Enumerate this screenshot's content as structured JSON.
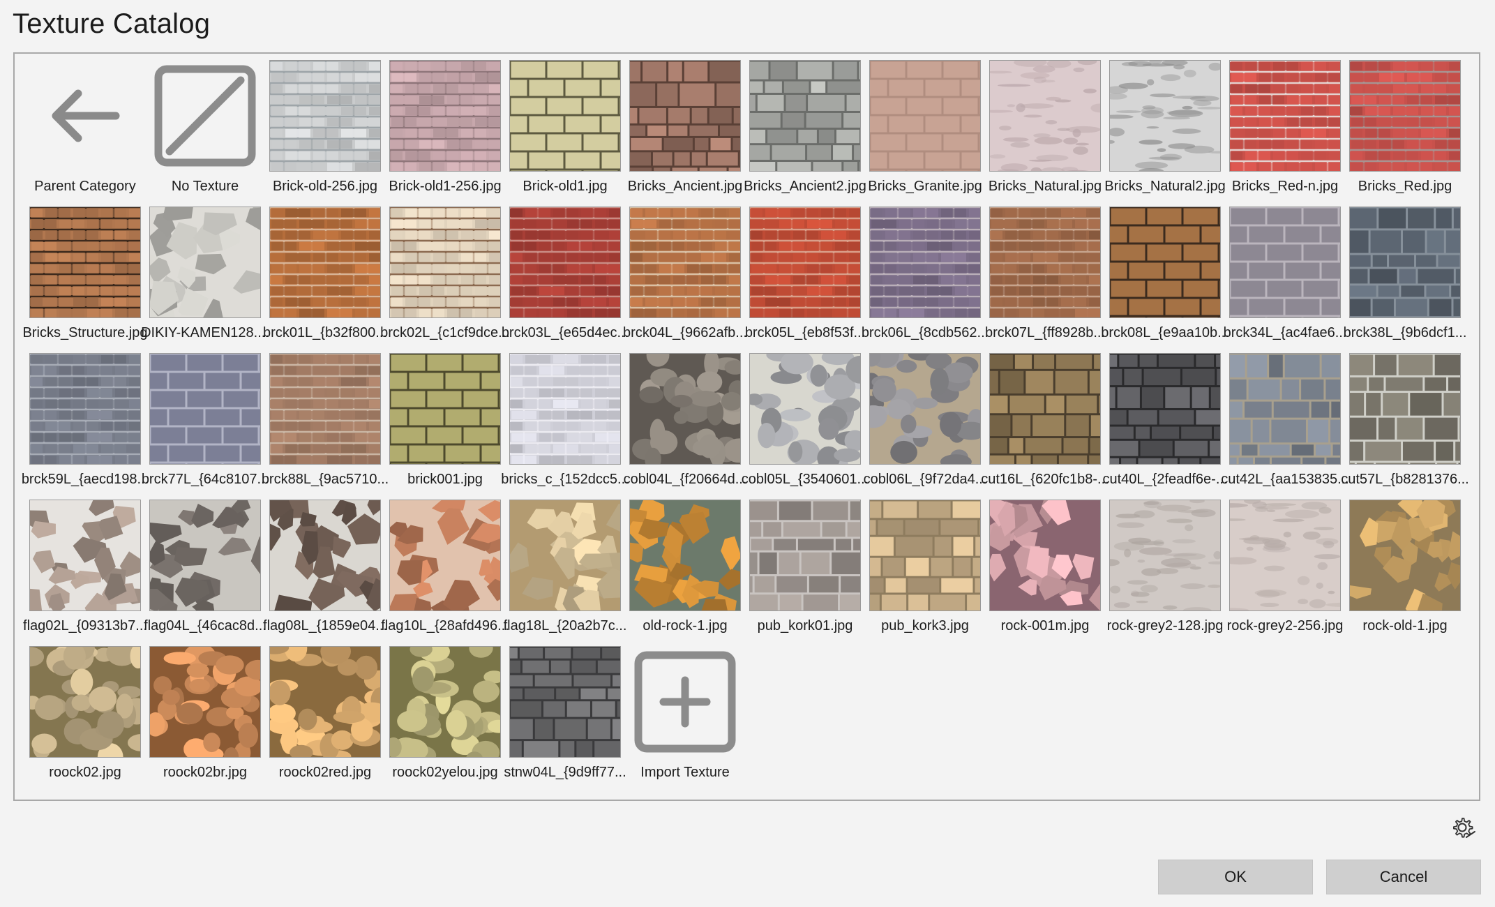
{
  "window": {
    "title": "Texture Catalog"
  },
  "special_items": {
    "parent": {
      "label": "Parent Category",
      "icon": "arrow-left-icon"
    },
    "none": {
      "label": "No Texture",
      "icon": "no-texture-icon"
    },
    "import": {
      "label": "Import Texture",
      "icon": "plus-square-icon"
    }
  },
  "textures": [
    {
      "label": "Brick-old-256.jpg",
      "colors": [
        "#c9cbcc",
        "#9ea5a9"
      ],
      "pattern": "brick"
    },
    {
      "label": "Brick-old1-256.jpg",
      "colors": [
        "#c7a7ac",
        "#8f767a"
      ],
      "pattern": "brick"
    },
    {
      "label": "Brick-old1.jpg",
      "colors": [
        "#d3cda0",
        "#5d5a40"
      ],
      "pattern": "block"
    },
    {
      "label": "Bricks_Ancient.jpg",
      "colors": [
        "#9d7566",
        "#5a4036"
      ],
      "pattern": "stone"
    },
    {
      "label": "Bricks_Ancient2.jpg",
      "colors": [
        "#a9aba7",
        "#6b6d6a"
      ],
      "pattern": "stone"
    },
    {
      "label": "Bricks_Granite.jpg",
      "colors": [
        "#c8a394",
        "#b08d7f"
      ],
      "pattern": "block"
    },
    {
      "label": "Bricks_Natural.jpg",
      "colors": [
        "#dccbcd",
        "#b9a6a9"
      ],
      "pattern": "rough"
    },
    {
      "label": "Bricks_Natural2.jpg",
      "colors": [
        "#d6d6d6",
        "#8f8f8f"
      ],
      "pattern": "rough"
    },
    {
      "label": "Bricks_Red-n.jpg",
      "colors": [
        "#c95049",
        "#e4d2cf"
      ],
      "pattern": "brick"
    },
    {
      "label": "Bricks_Red.jpg",
      "colors": [
        "#c8514c",
        "#a89391"
      ],
      "pattern": "brick"
    },
    {
      "label": "Bricks_Structure.jpg",
      "colors": [
        "#b1774f",
        "#3e2a1d"
      ],
      "pattern": "brick"
    },
    {
      "label": "DIKIY-KAMEN128....",
      "colors": [
        "#b8b7b2",
        "#dedcd7"
      ],
      "pattern": "flag"
    },
    {
      "label": "brck01L_{b32f800...",
      "colors": [
        "#b56d3b",
        "#d7b395"
      ],
      "pattern": "brick"
    },
    {
      "label": "brck02L_{c1cf9dce...",
      "colors": [
        "#e1d3bd",
        "#8b6a50"
      ],
      "pattern": "brick"
    },
    {
      "label": "brck03L_{e65d4ec...",
      "colors": [
        "#a83e36",
        "#c98c84"
      ],
      "pattern": "brick"
    },
    {
      "label": "brck04L_{9662afb...",
      "colors": [
        "#b36f44",
        "#d9c0a4"
      ],
      "pattern": "brick"
    },
    {
      "label": "brck05L_{eb8f53f...",
      "colors": [
        "#bf4b35",
        "#d99f8a"
      ],
      "pattern": "brick"
    },
    {
      "label": "brck06L_{8cdb562...",
      "colors": [
        "#7b6d88",
        "#b9aeb8"
      ],
      "pattern": "brick"
    },
    {
      "label": "brck07L_{ff8928b...",
      "colors": [
        "#9c6748",
        "#c6a38c"
      ],
      "pattern": "brick"
    },
    {
      "label": "brck08L_{e9aa10b...",
      "colors": [
        "#a57245",
        "#3b2b1e"
      ],
      "pattern": "block"
    },
    {
      "label": "brck34L_{ac4fae6...",
      "colors": [
        "#8d8893",
        "#bab5bd"
      ],
      "pattern": "block"
    },
    {
      "label": "brck38L_{9b6dcf1...",
      "colors": [
        "#5b6571",
        "#86909a"
      ],
      "pattern": "stone"
    },
    {
      "label": "brck59L_{aecd198...",
      "colors": [
        "#767b88",
        "#a7acb6"
      ],
      "pattern": "brick"
    },
    {
      "label": "brck77L_{64c8107...",
      "colors": [
        "#7c7f96",
        "#b2b4c6"
      ],
      "pattern": "block"
    },
    {
      "label": "brck88L_{9ac5710...",
      "colors": [
        "#a27b64",
        "#cab5a3"
      ],
      "pattern": "brick"
    },
    {
      "label": "brick001.jpg",
      "colors": [
        "#b1ac6f",
        "#4d4a2d"
      ],
      "pattern": "block"
    },
    {
      "label": "bricks_c_{152dcc5...",
      "colors": [
        "#cfcfd8",
        "#ecebf1"
      ],
      "pattern": "brick"
    },
    {
      "label": "cobl04L_{f20664d...",
      "colors": [
        "#8c857c",
        "#5f5953"
      ],
      "pattern": "cobble"
    },
    {
      "label": "cobl05L_{3540601...",
      "colors": [
        "#a8a9ad",
        "#d8d7cf"
      ],
      "pattern": "cobble"
    },
    {
      "label": "cobl06L_{9f72da4...",
      "colors": [
        "#8c8b8f",
        "#b5a78f"
      ],
      "pattern": "cobble"
    },
    {
      "label": "cut16L_{620fc1b8-...",
      "colors": [
        "#8f7955",
        "#4a3e2d"
      ],
      "pattern": "stone"
    },
    {
      "label": "cut40L_{2feadf6e-...",
      "colors": [
        "#5d5d61",
        "#2a2a2c"
      ],
      "pattern": "stone"
    },
    {
      "label": "cut42L_{aa153835...",
      "colors": [
        "#7d8591",
        "#a8a08e"
      ],
      "pattern": "stone"
    },
    {
      "label": "cut57L_{b8281376...",
      "colors": [
        "#7a766b",
        "#cfcfc8"
      ],
      "pattern": "stone"
    },
    {
      "label": "flag02L_{09313b7...",
      "colors": [
        "#a49388",
        "#e6e3df"
      ],
      "pattern": "flag"
    },
    {
      "label": "flag04L_{46cac8d...",
      "colors": [
        "#77706b",
        "#c9c6c0"
      ],
      "pattern": "flag"
    },
    {
      "label": "flag08L_{1859e04...",
      "colors": [
        "#6e5c52",
        "#dad7d1"
      ],
      "pattern": "flag"
    },
    {
      "label": "flag10L_{28afd496...",
      "colors": [
        "#bd7a59",
        "#e1c2ad"
      ],
      "pattern": "flag"
    },
    {
      "label": "flag18L_{20a2b7c...",
      "colors": [
        "#d8c49c",
        "#b39b71"
      ],
      "pattern": "flag"
    },
    {
      "label": "old-rock-1.jpg",
      "colors": [
        "#c98a36",
        "#6c7a6b"
      ],
      "pattern": "flag"
    },
    {
      "label": "pub_kork01.jpg",
      "colors": [
        "#9a928d",
        "#c9c4c1"
      ],
      "pattern": "stone"
    },
    {
      "label": "pub_kork3.jpg",
      "colors": [
        "#c9b08a",
        "#8e7c5e"
      ],
      "pattern": "stone"
    },
    {
      "label": "rock-001m.jpg",
      "colors": [
        "#d9a7ad",
        "#8a6570"
      ],
      "pattern": "flag"
    },
    {
      "label": "rock-grey2-128.jpg",
      "colors": [
        "#d0c9c5",
        "#aea6a1"
      ],
      "pattern": "rough"
    },
    {
      "label": "rock-grey2-256.jpg",
      "colors": [
        "#d8cdc9",
        "#b7aca8"
      ],
      "pattern": "rough"
    },
    {
      "label": "rock-old-1.jpg",
      "colors": [
        "#caa365",
        "#8e7a57"
      ],
      "pattern": "flag"
    },
    {
      "label": "roock02.jpg",
      "colors": [
        "#c9b58e",
        "#847650"
      ],
      "pattern": "cobble"
    },
    {
      "label": "roock02br.jpg",
      "colors": [
        "#d4905d",
        "#8b5a34"
      ],
      "pattern": "cobble"
    },
    {
      "label": "roock02red.jpg",
      "colors": [
        "#d9ab6f",
        "#8a6a3e"
      ],
      "pattern": "cobble"
    },
    {
      "label": "roock02yelou.jpg",
      "colors": [
        "#c2ba84",
        "#7a7548"
      ],
      "pattern": "cobble"
    },
    {
      "label": "stnw04L_{9d9ff77...",
      "colors": [
        "#6d6d6f",
        "#3a3a3c"
      ],
      "pattern": "stone"
    }
  ],
  "footer": {
    "settings_icon": "gear-icon",
    "ok_label": "OK",
    "cancel_label": "Cancel"
  }
}
